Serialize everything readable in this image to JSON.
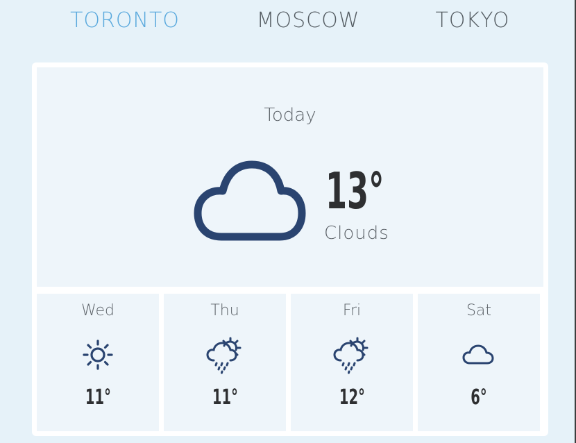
{
  "tabs": [
    {
      "label": "TORONTO",
      "active": true
    },
    {
      "label": "MOSCOW",
      "active": false
    },
    {
      "label": "TOKYO",
      "active": false
    }
  ],
  "today": {
    "label": "Today",
    "temperature": "13°",
    "description": "Clouds",
    "icon": "cloud-icon"
  },
  "forecast": [
    {
      "day": "Wed",
      "temperature": "11°",
      "icon": "sun-icon"
    },
    {
      "day": "Thu",
      "temperature": "11°",
      "icon": "sun-cloud-rain-icon"
    },
    {
      "day": "Fri",
      "temperature": "12°",
      "icon": "sun-cloud-rain-icon"
    },
    {
      "day": "Sat",
      "temperature": "6°",
      "icon": "cloud-icon"
    }
  ],
  "colors": {
    "background": "#e6f2f9",
    "active_tab": "#5aa9dd",
    "inactive_tab": "#555d63",
    "icon": "#2a4470",
    "panel": "#eef5fa"
  }
}
